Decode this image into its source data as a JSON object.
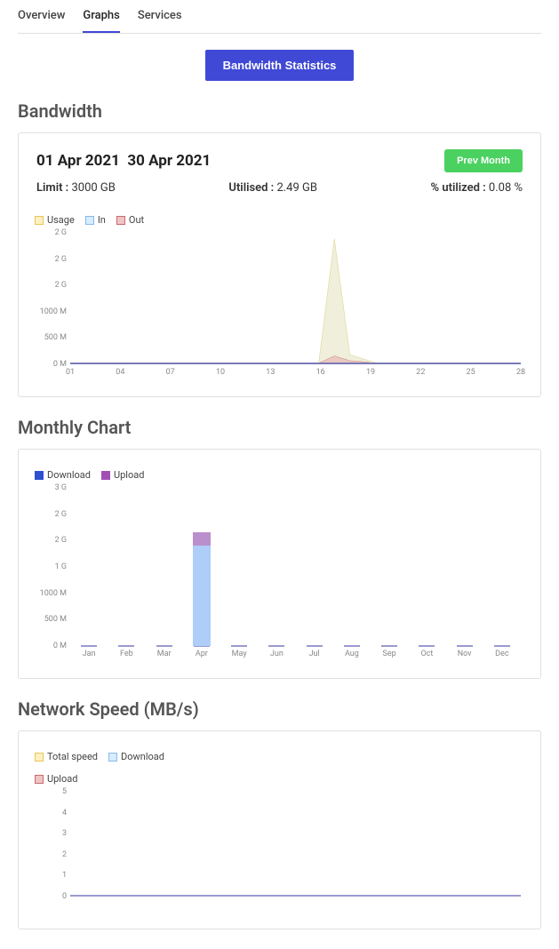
{
  "tabs": {
    "overview": "Overview",
    "graphs": "Graphs",
    "services": "Services"
  },
  "button_primary": "Bandwidth Statistics",
  "bandwidth": {
    "title": "Bandwidth",
    "date_from": "01 Apr 2021",
    "date_to": "30 Apr 2021",
    "prev_month": "Prev Month",
    "limit_label": "Limit :",
    "limit_value": "3000 GB",
    "utilised_label": "Utilised :",
    "utilised_value": "2.49 GB",
    "pct_label": "% utilized :",
    "pct_value": "0.08 %",
    "legend": {
      "usage": "Usage",
      "in": "In",
      "out": "Out"
    }
  },
  "monthly": {
    "title": "Monthly Chart",
    "legend": {
      "download": "Download",
      "upload": "Upload"
    }
  },
  "network": {
    "title": "Network Speed (MB/s)",
    "legend": {
      "total": "Total speed",
      "download": "Download",
      "upload": "Upload"
    }
  },
  "chart_data": [
    {
      "id": "bandwidth_daily",
      "type": "area",
      "title": "Bandwidth",
      "x": [
        "01",
        "04",
        "07",
        "10",
        "13",
        "16",
        "19",
        "22",
        "25",
        "28"
      ],
      "yticks": [
        "0 M",
        "500 M",
        "1000 M",
        "2 G",
        "2 G",
        "2 G"
      ],
      "ylim": [
        0,
        2200
      ],
      "series": [
        {
          "name": "Usage",
          "color": "#e8e8cc",
          "stroke": "#d6c66a",
          "values": [
            0,
            0,
            0,
            0,
            0,
            0,
            0,
            0,
            0,
            0,
            0,
            0,
            0,
            0,
            0,
            0,
            30,
            2100,
            160,
            80,
            0,
            0,
            0,
            0,
            0,
            0,
            0,
            0,
            0,
            0
          ]
        },
        {
          "name": "In",
          "color": "#d6ecff",
          "stroke": "#8bb8e8",
          "values": [
            0,
            0,
            0,
            0,
            0,
            0,
            0,
            0,
            0,
            0,
            0,
            0,
            0,
            0,
            0,
            0,
            0,
            0,
            0,
            0,
            0,
            0,
            0,
            0,
            0,
            0,
            0,
            0,
            0,
            0
          ]
        },
        {
          "name": "Out",
          "color": "#e8b8b8",
          "stroke": "#c86a6a",
          "values": [
            0,
            0,
            0,
            0,
            0,
            0,
            0,
            0,
            0,
            0,
            0,
            0,
            0,
            0,
            0,
            0,
            20,
            140,
            60,
            40,
            0,
            0,
            0,
            0,
            0,
            0,
            0,
            0,
            0,
            0
          ]
        }
      ]
    },
    {
      "id": "monthly_bar",
      "type": "bar",
      "title": "Monthly Chart",
      "categories": [
        "Jan",
        "Feb",
        "Mar",
        "Apr",
        "May",
        "Jun",
        "Jul",
        "Aug",
        "Sep",
        "Oct",
        "Nov",
        "Dec"
      ],
      "yticks": [
        "0 M",
        "500 M",
        "1000 M",
        "1 G",
        "2 G",
        "2 G",
        "3 G"
      ],
      "ylim": [
        0,
        3000
      ],
      "series": [
        {
          "name": "Download",
          "color": "#aecdf9",
          "values": [
            0,
            0,
            0,
            1900,
            0,
            0,
            0,
            0,
            0,
            0,
            0,
            0
          ]
        },
        {
          "name": "Upload",
          "color": "#ba8fcb",
          "values": [
            0,
            0,
            0,
            250,
            0,
            0,
            0,
            0,
            0,
            0,
            0,
            0
          ]
        }
      ]
    },
    {
      "id": "network_speed",
      "type": "line",
      "title": "Network Speed (MB/s)",
      "yticks": [
        "0",
        "1",
        "2",
        "3",
        "4",
        "5"
      ],
      "ylim": [
        0,
        5
      ],
      "series": [
        {
          "name": "Total speed",
          "values": []
        },
        {
          "name": "Download",
          "values": []
        },
        {
          "name": "Upload",
          "values": []
        }
      ]
    }
  ]
}
